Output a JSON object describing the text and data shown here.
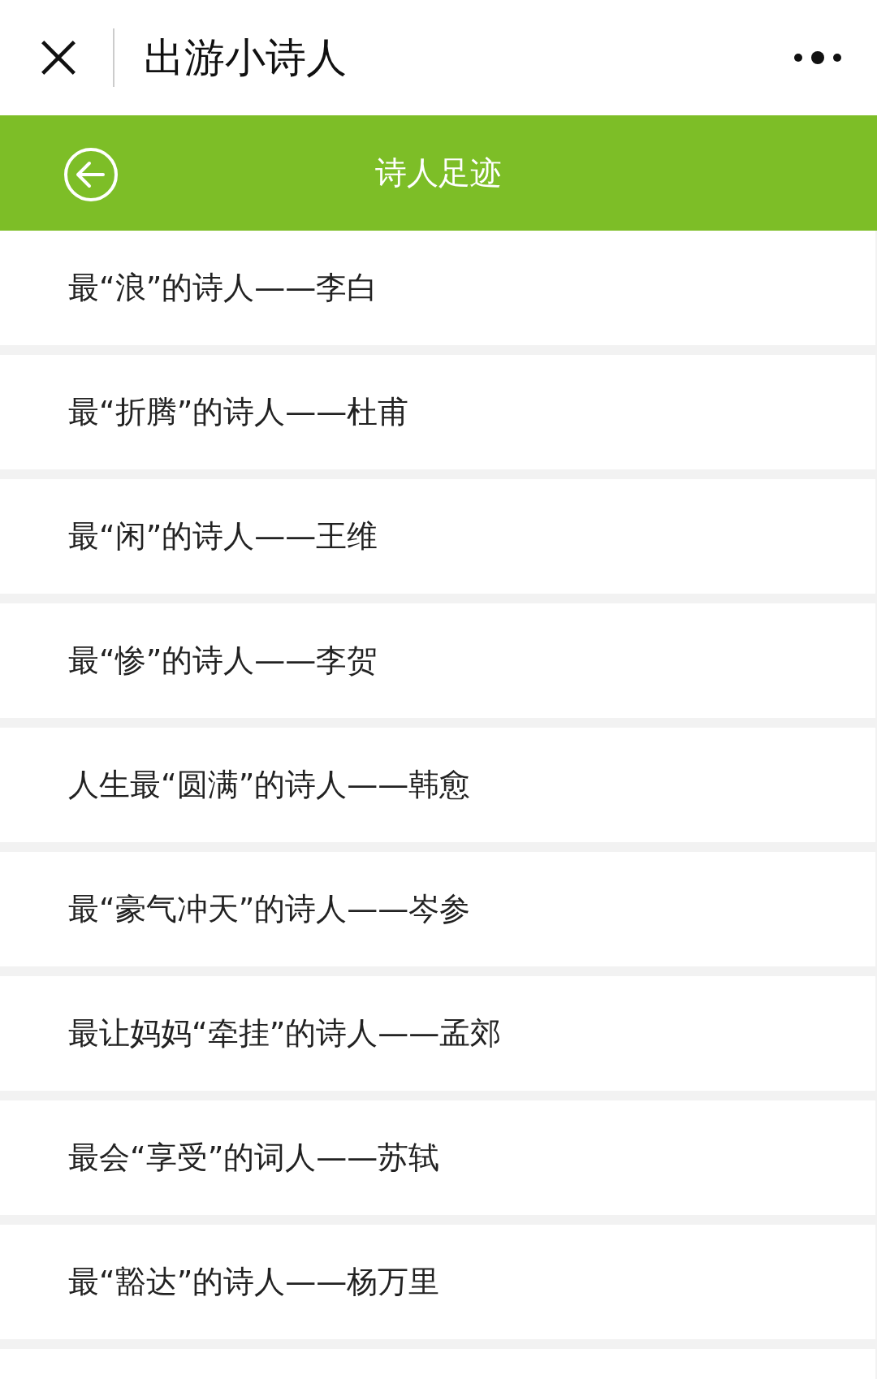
{
  "header": {
    "title": "出游小诗人"
  },
  "nav": {
    "title": "诗人足迹"
  },
  "items": [
    {
      "label": "最“浪”的诗人——李白"
    },
    {
      "label": "最“折腾”的诗人——杜甫"
    },
    {
      "label": "最“闲”的诗人——王维"
    },
    {
      "label": "最“惨”的诗人——李贺"
    },
    {
      "label": "人生最“圆满”的诗人——韩愈"
    },
    {
      "label": "最“豪气冲天”的诗人——岑参"
    },
    {
      "label": "最让妈妈“牵挂”的诗人——孟郊"
    },
    {
      "label": "最会“享受”的词人——苏轼"
    },
    {
      "label": "最“豁达”的诗人——杨万里"
    }
  ]
}
